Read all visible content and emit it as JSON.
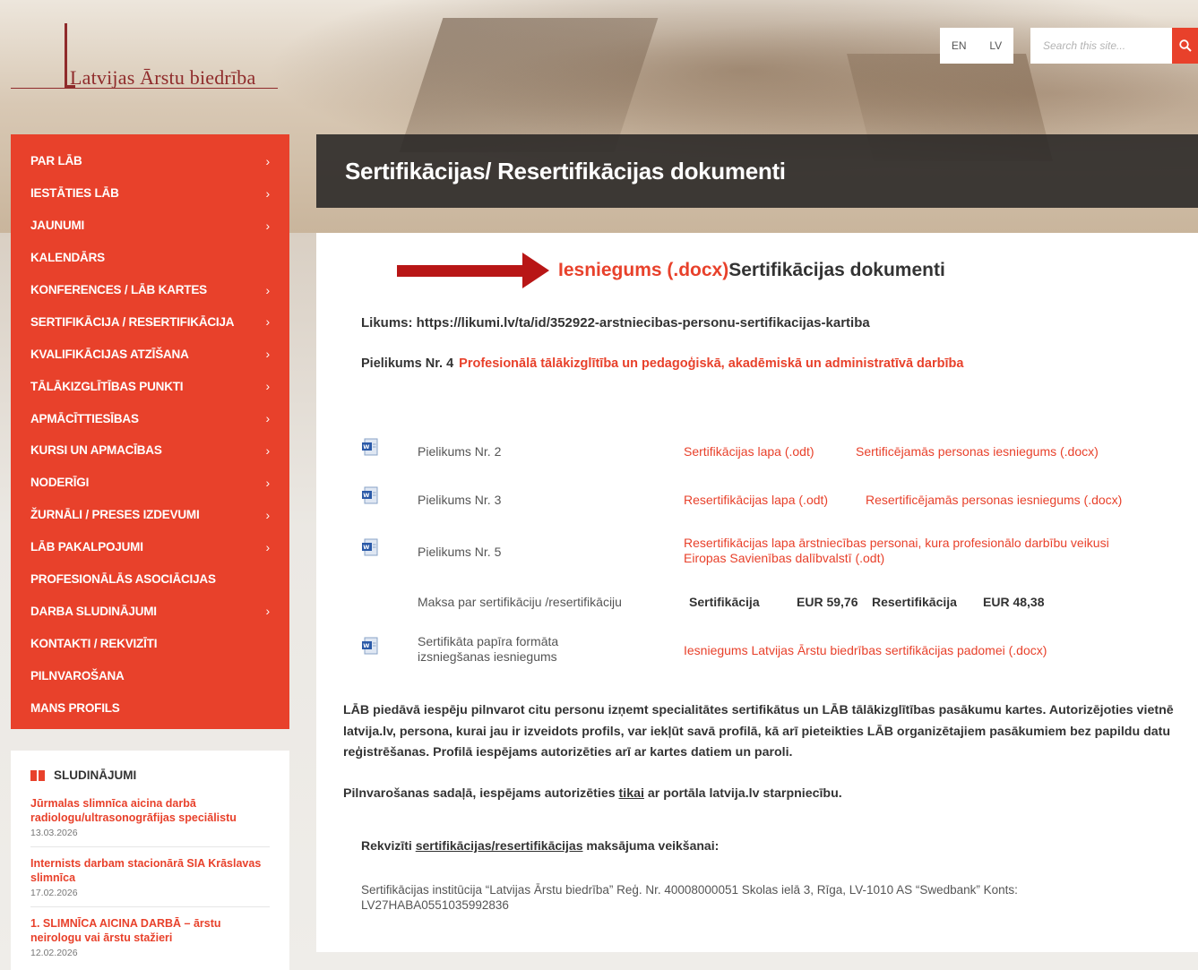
{
  "header": {
    "logo_text": "Latvijas Ārstu biedrība",
    "lang_en": "EN",
    "lang_lv": "LV",
    "search_placeholder": "Search this site...",
    "accent": "#e8412b"
  },
  "sidebar": {
    "items": [
      {
        "label": "PAR LĀB",
        "chevron": "›"
      },
      {
        "label": "IESTĀTIES LĀB",
        "chevron": "›"
      },
      {
        "label": "JAUNUMI",
        "chevron": "›"
      },
      {
        "label": "KALENDĀRS",
        "chevron": ""
      },
      {
        "label": "KONFERENCES / LĀB KARTES",
        "chevron": "›"
      },
      {
        "label": "SERTIFIKĀCIJA / RESERTIFIKĀCIJA",
        "chevron": "›"
      },
      {
        "label": "KVALIFIKĀCIJAS ATZĪŠANA",
        "chevron": "›"
      },
      {
        "label": "TĀLĀKIZGLĪTĪBAS PUNKTI",
        "chevron": "›"
      },
      {
        "label": "APMĀCĪTTIESĪBAS",
        "chevron": "›"
      },
      {
        "label": "KURSI UN APMACĪBAS",
        "chevron": "›"
      },
      {
        "label": "NODERĪGI",
        "chevron": "›"
      },
      {
        "label": "ŽURNĀLI / PRESES IZDEVUMI",
        "chevron": "›"
      },
      {
        "label": "LĀB PAKALPOJUMI",
        "chevron": "›"
      },
      {
        "label": "PROFESIONĀLĀS ASOCIĀCIJAS",
        "chevron": ""
      },
      {
        "label": "DARBA SLUDINĀJUMI",
        "chevron": "›"
      },
      {
        "label": "KONTAKTI / REKVIZĪTI",
        "chevron": ""
      },
      {
        "label": "PILNVAROŠANA",
        "chevron": ""
      },
      {
        "label": "MANS PROFILS",
        "chevron": ""
      }
    ]
  },
  "announcements": {
    "heading": "SLUDINĀJUMI",
    "items": [
      {
        "title": "Jūrmalas slimnīca aicina darbā radiologu/ultrasonogrāfijas speciālistu",
        "date": "13.03.2026"
      },
      {
        "title": "Internists darbam stacionārā SIA Krāslavas slimnīca",
        "date": "17.02.2026"
      },
      {
        "title": "1. SLIMNĪCA AICINA DARBĀ – ārstu neirologu vai ārstu stažieri",
        "date": "12.02.2026"
      }
    ]
  },
  "page": {
    "title": "Sertifikācijas/ Resertifikācijas dokumenti",
    "heading_link": "Iesniegums (.docx)",
    "heading_rest": "Sertifikācijas dokumenti",
    "likums": "Likums: https://likumi.lv/ta/id/352922-arstniecibas-personu-sertifikacijas-kartiba",
    "pielikums4_label": "Pielikums Nr. 4",
    "pielikums4_link": "Profesionālā tālākizglītība un pedagoģiskā, akadēmiskā un administratīvā darbība",
    "rows": [
      {
        "label": "Pielikums Nr. 2",
        "link1": "Sertifikācijas lapa (.odt)",
        "link2": "Sertificējamās personas iesniegums (.docx)"
      },
      {
        "label": "Pielikums Nr. 3",
        "link1": "Resertifikācijas lapa (.odt)",
        "link2": "Resertificējamās personas iesniegums (.docx)"
      },
      {
        "label": "Pielikums Nr. 5",
        "link1": "Resertifikācijas lapa ārstniecības personai, kura profesionālo darbību veikusi Eiropas Savienības dalībvalstī (.odt)"
      },
      {
        "label": "Sertifikāta papīra formāta izsniegšanas iesniegums",
        "link1": "Iesniegums Latvijas Ārstu biedrības sertifikācijas padomei (.docx)"
      }
    ],
    "fees": {
      "label": "Maksa par sertifikāciju /resertifikāciju",
      "cert_label": "Sertifikācija",
      "cert_value": "EUR 59,76",
      "recert_label": "Resertifikācija",
      "recert_value": "EUR 48,38"
    },
    "paragraph": "LĀB piedāvā iespēju pilnvarot citu personu izņemt specialitātes sertifikātus un LĀB tālākizglītības pasākumu kartes. Autorizējoties vietnē latvija.lv, persona, kurai jau ir izveidots profils, var iekļūt savā profilā, kā arī pieteikties LĀB organizētajiem pasākumiem bez papildu datu reģistrēšanas. Profilā iespējams autorizēties arī ar kartes datiem un paroli.",
    "pilnv_before": "Pilnvarošanas sadaļā,  iespējams autorizēties ",
    "pilnv_under": "tikai",
    "pilnv_after": " ar portāla latvija.lv starpniecību.",
    "rek_before": "Rekvizīti ",
    "rek_under": "sertifikācijas/resertifikācijas",
    "rek_after": " maksājuma veikšanai:",
    "institution": "Sertifikācijas institūcija “Latvijas Ārstu biedrība” Reģ. Nr. 40008000051 Skolas ielā 3, Rīga, LV-1010 AS “Swedbank” Konts: LV27HABA0551035992836"
  }
}
